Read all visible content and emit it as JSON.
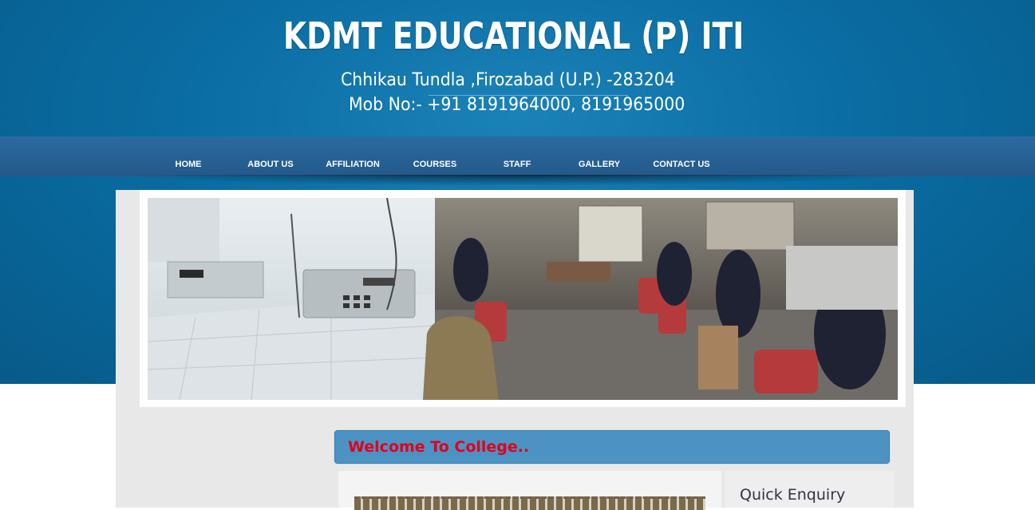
{
  "header": {
    "title": "KDMT EDUCATIONAL (P) ITI",
    "address": "Chhikau Tundla ,Firozabad (U.P.) -283204",
    "phone": "Mob No:- +91 8191964000, 8191965000"
  },
  "nav": {
    "items": [
      {
        "label": "HOME"
      },
      {
        "label": "ABOUT US"
      },
      {
        "label": "AFFILIATION"
      },
      {
        "label": "COURSES"
      },
      {
        "label": "STAFF"
      },
      {
        "label": "GALLERY"
      },
      {
        "label": "CONTACT US"
      }
    ]
  },
  "banner": {
    "description": ""
  },
  "main": {
    "welcome": "Welcome To College.."
  },
  "sidebar": {
    "quick_enquiry": "Quick Enquiry"
  },
  "colors": {
    "header_blue": "#0a6da3",
    "nav_blue": "#2a6aa0",
    "welcome_bar": "#4c93c4",
    "welcome_text": "#e2001a"
  }
}
